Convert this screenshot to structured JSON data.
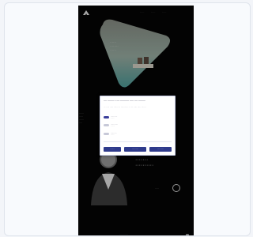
{
  "app": {
    "background": "#f3f5f9",
    "card_background": "#f8fafd"
  },
  "site": {
    "logo": "site-logo",
    "nav": [
      "·····",
      "·····",
      "·····"
    ],
    "hero": {
      "text": [
        "······",
        "········",
        "······"
      ],
      "accent": "#8ab3ab"
    },
    "side_left": "······\n·····\n······\n····",
    "side_right": "········\n······\n·········\n·····",
    "big_title": [
      "··········",
      "·······",
      "··········"
    ],
    "more_link": "·····",
    "footer": "···········"
  },
  "consent": {
    "title": "···· ········ ·· ···· ··········· ····· ····\n·········",
    "description": "··· ····· ····· ······ ··· ··········· ·· ····\n····· ····· ·······",
    "options": [
      {
        "label": "··········",
        "sub": "·······",
        "enabled": true
      },
      {
        "label": "···········",
        "sub": "········",
        "enabled": false
      },
      {
        "label": "·········",
        "sub": "·······",
        "enabled": false
      }
    ],
    "buttons": [
      "·······",
      "··········",
      "··········"
    ],
    "accent": "#2f3b8c"
  }
}
